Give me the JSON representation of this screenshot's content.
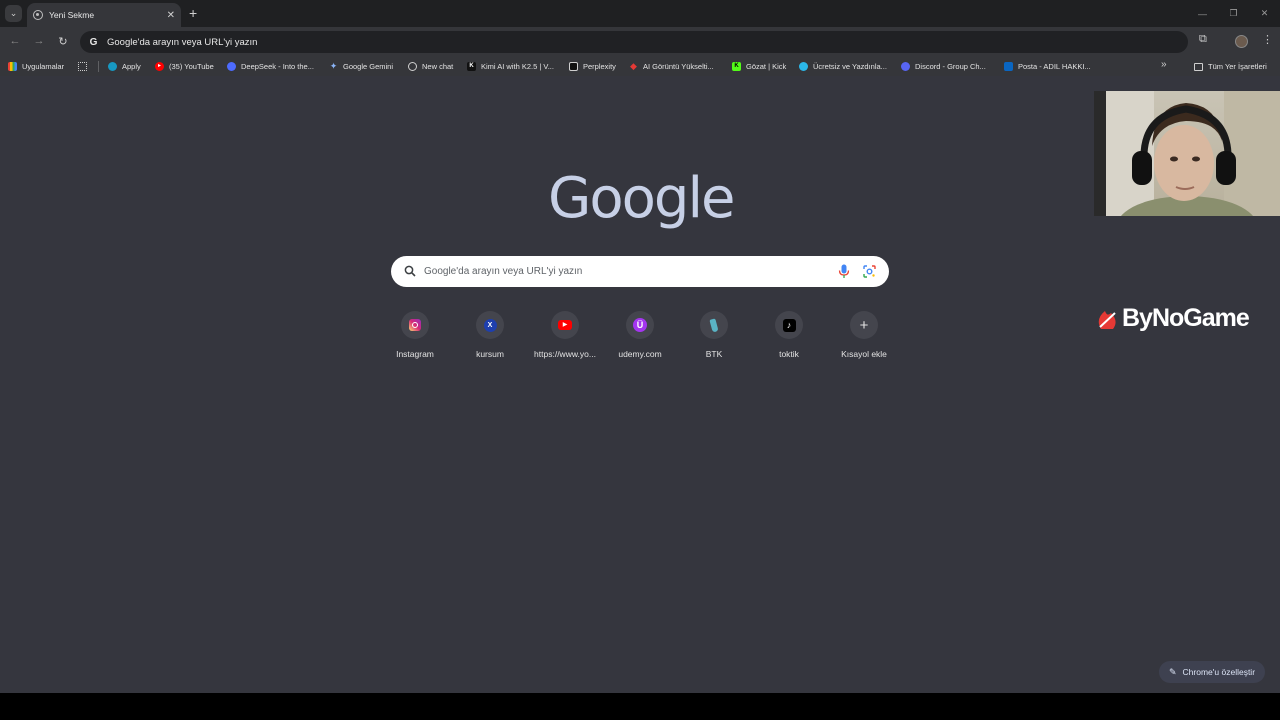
{
  "tab": {
    "title": "Yeni Sekme",
    "close": "✕",
    "new_tab": "+"
  },
  "window": {
    "minimize": "—",
    "restore": "❐",
    "close": "✕"
  },
  "toolbar": {
    "back": "←",
    "forward": "→",
    "reload": "↻",
    "omnibox_text": "Google'da arayın veya URL'yi yazın",
    "extensions": "⧉",
    "menu": "⋮"
  },
  "bookmarks": {
    "items": [
      {
        "label": "Uygulamalar",
        "icon": "apps-icon",
        "color": "#f4b400"
      },
      {
        "label": "Apply",
        "icon": "salesforce-icon",
        "color": "#1798c1"
      },
      {
        "label": "(35) YouTube",
        "icon": "youtube-icon",
        "color": "#ff0000"
      },
      {
        "label": "DeepSeek - Into the...",
        "icon": "deepseek-icon",
        "color": "#4d6bfe"
      },
      {
        "label": "Google Gemini",
        "icon": "gemini-icon",
        "color": "#8ab4f8"
      },
      {
        "label": "New chat",
        "icon": "chatgpt-icon",
        "color": "#9aa0a6"
      },
      {
        "label": "Kimi AI with K2.5 | V...",
        "icon": "kimi-icon",
        "color": "#111111"
      },
      {
        "label": "Perplexity",
        "icon": "perplexity-icon",
        "color": "#20808d"
      },
      {
        "label": "AI Görüntü Yükselti...",
        "icon": "ai-upscale-icon",
        "color": "#e53935"
      },
      {
        "label": "Gözat | Kick",
        "icon": "kick-icon",
        "color": "#53fc18"
      },
      {
        "label": "Ücretsiz ve Yazdınla...",
        "icon": "edge-icon",
        "color": "#2bb7e8"
      },
      {
        "label": "Discord - Group Ch...",
        "icon": "discord-icon",
        "color": "#5865f2"
      },
      {
        "label": "Posta - ADIL HAKKI...",
        "icon": "outlook-icon",
        "color": "#0a66c2"
      }
    ],
    "more": "»",
    "all_bookmarks": "Tüm Yer İşaretleri"
  },
  "logo": "Google",
  "search": {
    "placeholder": "Google'da arayın veya URL'yi yazın"
  },
  "shortcuts": [
    {
      "label": "Instagram",
      "icon": "instagram-icon"
    },
    {
      "label": "kursum",
      "icon": "kursum-icon"
    },
    {
      "label": "https://www.yo...",
      "icon": "youtube-icon"
    },
    {
      "label": "udemy.com",
      "icon": "udemy-icon"
    },
    {
      "label": "BTK",
      "icon": "btk-icon"
    },
    {
      "label": "toktik",
      "icon": "tiktok-icon"
    },
    {
      "label": "Kısayol ekle",
      "icon": "add-icon"
    }
  ],
  "overlay": {
    "brand": "ByNoGame"
  },
  "customize": {
    "label": "Chrome'u özelleştir"
  }
}
